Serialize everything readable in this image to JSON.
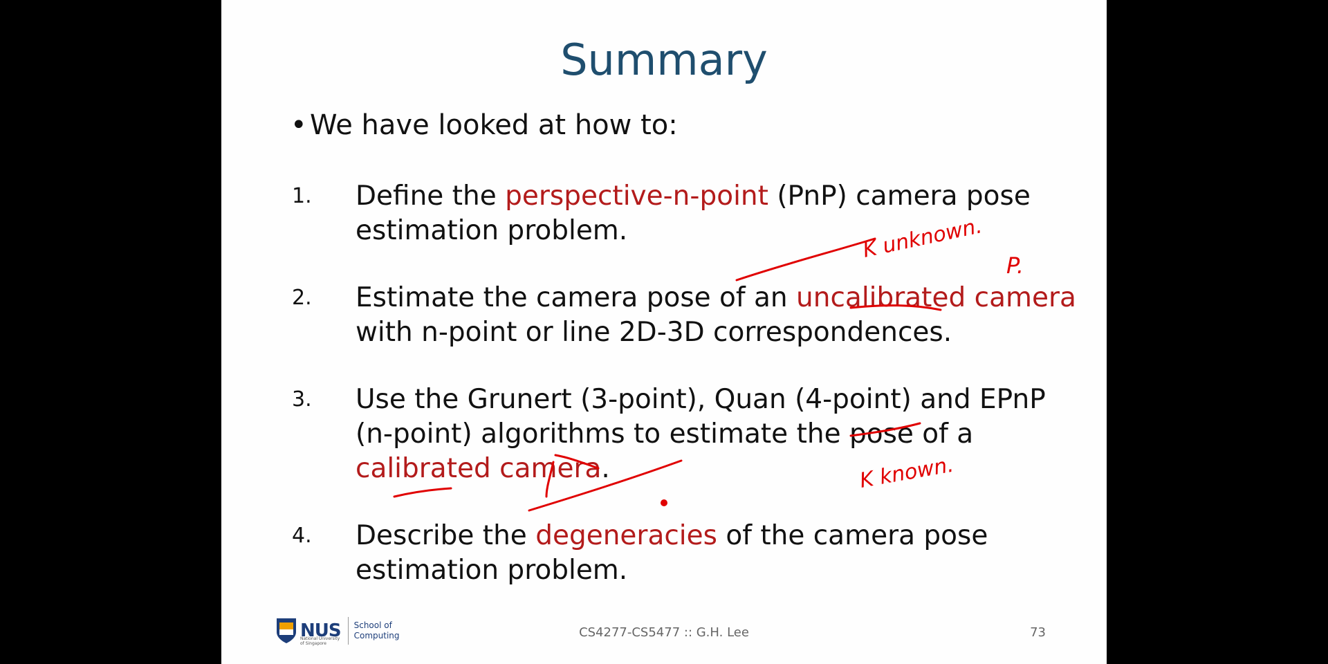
{
  "slide": {
    "title": "Summary",
    "intro_bullet": "We have looked at how to:",
    "items": [
      {
        "num": "1.",
        "parts": [
          "Define the ",
          "perspective-n-point",
          " (PnP) camera pose estimation problem."
        ]
      },
      {
        "num": "2.",
        "parts": [
          "Estimate the camera pose of an ",
          "uncalibrated camera",
          " with n-point or line 2D-3D correspondences."
        ]
      },
      {
        "num": "3.",
        "parts": [
          "Use the Grunert (3-point), Quan (4-point) and EPnP (n-point) algorithms to estimate the pose of a ",
          "calibrated camera",
          "."
        ]
      },
      {
        "num": "4.",
        "parts": [
          "Describe the ",
          "degeneracies",
          " of the camera pose estimation problem."
        ]
      }
    ],
    "annotations": {
      "k_unknown": "K unknown.",
      "p_label": "P.",
      "k_known": "K known."
    },
    "footer": {
      "course": "CS4277-CS5477 :: G.H. Lee",
      "page": "73",
      "logo_text": "NUS",
      "logo_subtext": "National University of Singapore",
      "school_line1": "School of",
      "school_line2": "Computing"
    }
  },
  "colors": {
    "title": "#1f4e6e",
    "highlight": "#b31b1b",
    "ink": "#e00000",
    "background": "#000000"
  }
}
